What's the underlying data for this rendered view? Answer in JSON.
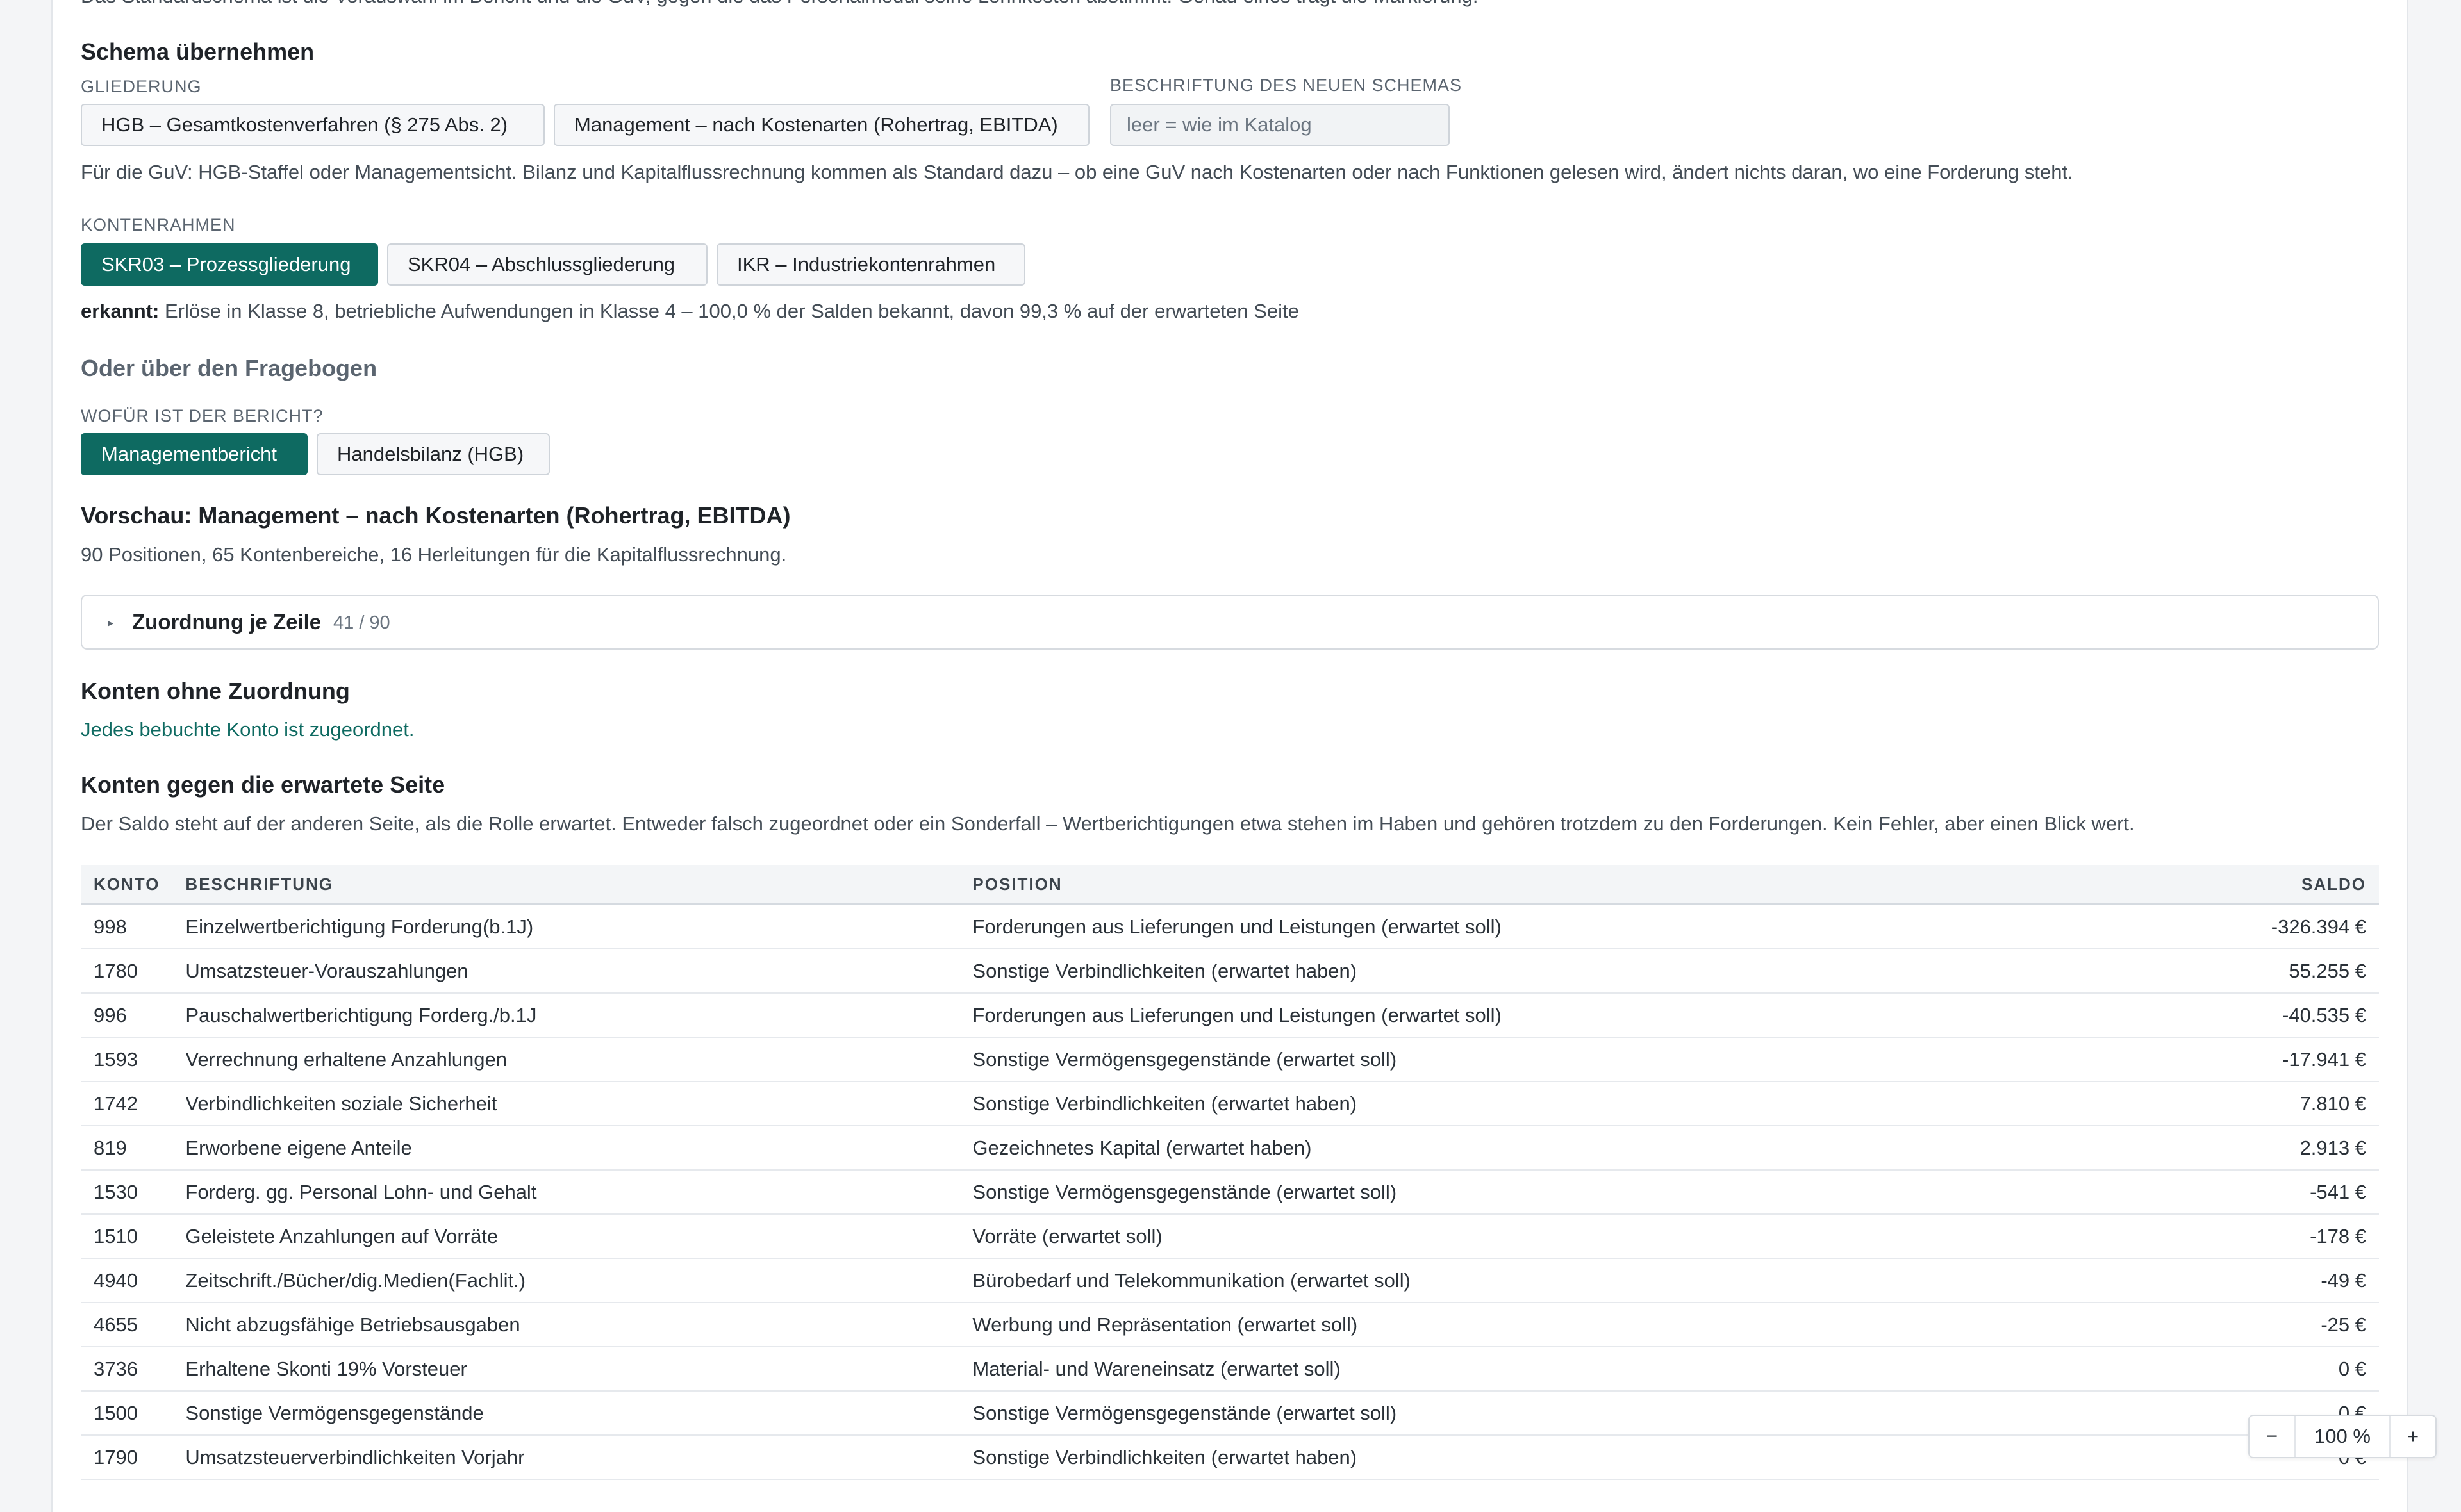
{
  "intro_text_cut": "Das Standardschema ist die Vorauswahl im Bericht und die GuV, gegen die das Personalmodul seine Lohnkosten abstimmt. Genau eines trägt die Markierung.",
  "schema": {
    "heading": "Schema übernehmen",
    "gliederung_caption": "GLIEDERUNG",
    "gliederung_options": [
      {
        "label": "HGB – Gesamtkostenverfahren (§ 275 Abs. 2)",
        "active": false
      },
      {
        "label": "Management – nach Kostenarten (Rohertrag, EBITDA)",
        "active": false
      }
    ],
    "new_label_caption": "BESCHRIFTUNG DES NEUEN SCHEMAS",
    "new_label_placeholder": "leer = wie im Katalog",
    "guv_hint": "Für die GuV: HGB-Staffel oder Managementsicht. Bilanz und Kapitalflussrechnung kommen als Standard dazu – ob eine GuV nach Kostenarten oder nach Funktionen gelesen wird, ändert nichts daran, wo eine Forderung steht.",
    "kontenrahmen_caption": "KONTENRAHMEN",
    "kontenrahmen_options": [
      {
        "label": "SKR03 – Prozessgliederung",
        "active": true
      },
      {
        "label": "SKR04 – Abschlussgliederung",
        "active": false
      },
      {
        "label": "IKR – Industriekontenrahmen",
        "active": false
      }
    ],
    "detected_label": "erkannt:",
    "detected_text": "Erlöse in Klasse 8, betriebliche Aufwendungen in Klasse 4 – 100,0 % der Salden bekannt, davon 99,3 % auf der erwarteten Seite"
  },
  "fragebogen": {
    "heading": "Oder über den Fragebogen",
    "question_caption": "WOFÜR IST DER BERICHT?",
    "options": [
      {
        "label": "Managementbericht",
        "active": true
      },
      {
        "label": "Handelsbilanz (HGB)",
        "active": false
      }
    ]
  },
  "preview": {
    "heading": "Vorschau: Management – nach Kostenarten (Rohertrag, EBITDA)",
    "summary": "90 Positionen, 65 Kontenbereiche, 16 Herleitungen für die Kapitalflussrechnung.",
    "details_title": "Zuordnung je Zeile",
    "details_count": "41 / 90"
  },
  "unassigned": {
    "heading": "Konten ohne Zuordnung",
    "message": "Jedes bebuchte Konto ist zugeordnet."
  },
  "wrong_side": {
    "heading": "Konten gegen die erwartete Seite",
    "description": "Der Saldo steht auf der anderen Seite, als die Rolle erwartet. Entweder falsch zugeordnet oder ein Sonderfall – Wertberichtigungen etwa stehen im Haben und gehören trotzdem zu den Forderungen. Kein Fehler, aber einen Blick wert.",
    "columns": [
      "KONTO",
      "BESCHRIFTUNG",
      "POSITION",
      "SALDO"
    ],
    "rows": [
      {
        "konto": "998",
        "label": "Einzelwertberichtigung Forderung(b.1J)",
        "position": "Forderungen aus Lieferungen und Leistungen (erwartet soll)",
        "saldo": "-326.394 €"
      },
      {
        "konto": "1780",
        "label": "Umsatzsteuer-Vorauszahlungen",
        "position": "Sonstige Verbindlichkeiten (erwartet haben)",
        "saldo": "55.255 €"
      },
      {
        "konto": "996",
        "label": "Pauschalwertberichtigung Forderg./b.1J",
        "position": "Forderungen aus Lieferungen und Leistungen (erwartet soll)",
        "saldo": "-40.535 €"
      },
      {
        "konto": "1593",
        "label": "Verrechnung erhaltene Anzahlungen",
        "position": "Sonstige Vermögensgegenstände (erwartet soll)",
        "saldo": "-17.941 €"
      },
      {
        "konto": "1742",
        "label": "Verbindlichkeiten soziale Sicherheit",
        "position": "Sonstige Verbindlichkeiten (erwartet haben)",
        "saldo": "7.810 €"
      },
      {
        "konto": "819",
        "label": "Erworbene eigene Anteile",
        "position": "Gezeichnetes Kapital (erwartet haben)",
        "saldo": "2.913 €"
      },
      {
        "konto": "1530",
        "label": "Forderg. gg. Personal Lohn- und Gehalt",
        "position": "Sonstige Vermögensgegenstände (erwartet soll)",
        "saldo": "-541 €"
      },
      {
        "konto": "1510",
        "label": "Geleistete Anzahlungen auf Vorräte",
        "position": "Vorräte (erwartet soll)",
        "saldo": "-178 €"
      },
      {
        "konto": "4940",
        "label": "Zeitschrift./Bücher/dig.Medien(Fachlit.)",
        "position": "Bürobedarf und Telekommunikation (erwartet soll)",
        "saldo": "-49 €"
      },
      {
        "konto": "4655",
        "label": "Nicht abzugsfähige Betriebsausgaben",
        "position": "Werbung und Repräsentation (erwartet soll)",
        "saldo": "-25 €"
      },
      {
        "konto": "3736",
        "label": "Erhaltene Skonti 19% Vorsteuer",
        "position": "Material- und Wareneinsatz (erwartet soll)",
        "saldo": "0 €"
      },
      {
        "konto": "1500",
        "label": "Sonstige Vermögensgegenstände",
        "position": "Sonstige Vermögensgegenstände (erwartet soll)",
        "saldo": "0 €"
      },
      {
        "konto": "1790",
        "label": "Umsatzsteuerverbindlichkeiten Vorjahr",
        "position": "Sonstige Verbindlichkeiten (erwartet haben)",
        "saldo": "0 €"
      }
    ]
  },
  "zoom": {
    "minus": "−",
    "value": "100 %",
    "plus": "+"
  },
  "colors": {
    "accent": "#0e6a61",
    "text": "#1f2328",
    "muted": "#5b6570"
  }
}
